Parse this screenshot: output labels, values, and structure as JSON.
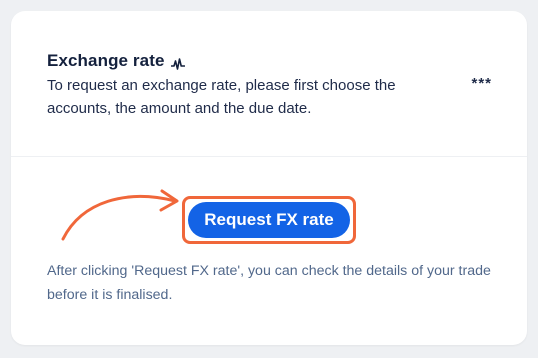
{
  "card": {
    "title": "Exchange rate",
    "title_icon": "pulse-icon",
    "description": "To request an exchange rate, please first choose the accounts, the amount and the due date.",
    "more_label": "***"
  },
  "action": {
    "button_label": "Request FX rate",
    "note": "After clicking 'Request FX rate', you can check the details of your trade before it is finalised."
  },
  "colors": {
    "button": "#1363e6",
    "highlight": "#f0673a",
    "title": "#14213d",
    "note": "#51688b"
  }
}
